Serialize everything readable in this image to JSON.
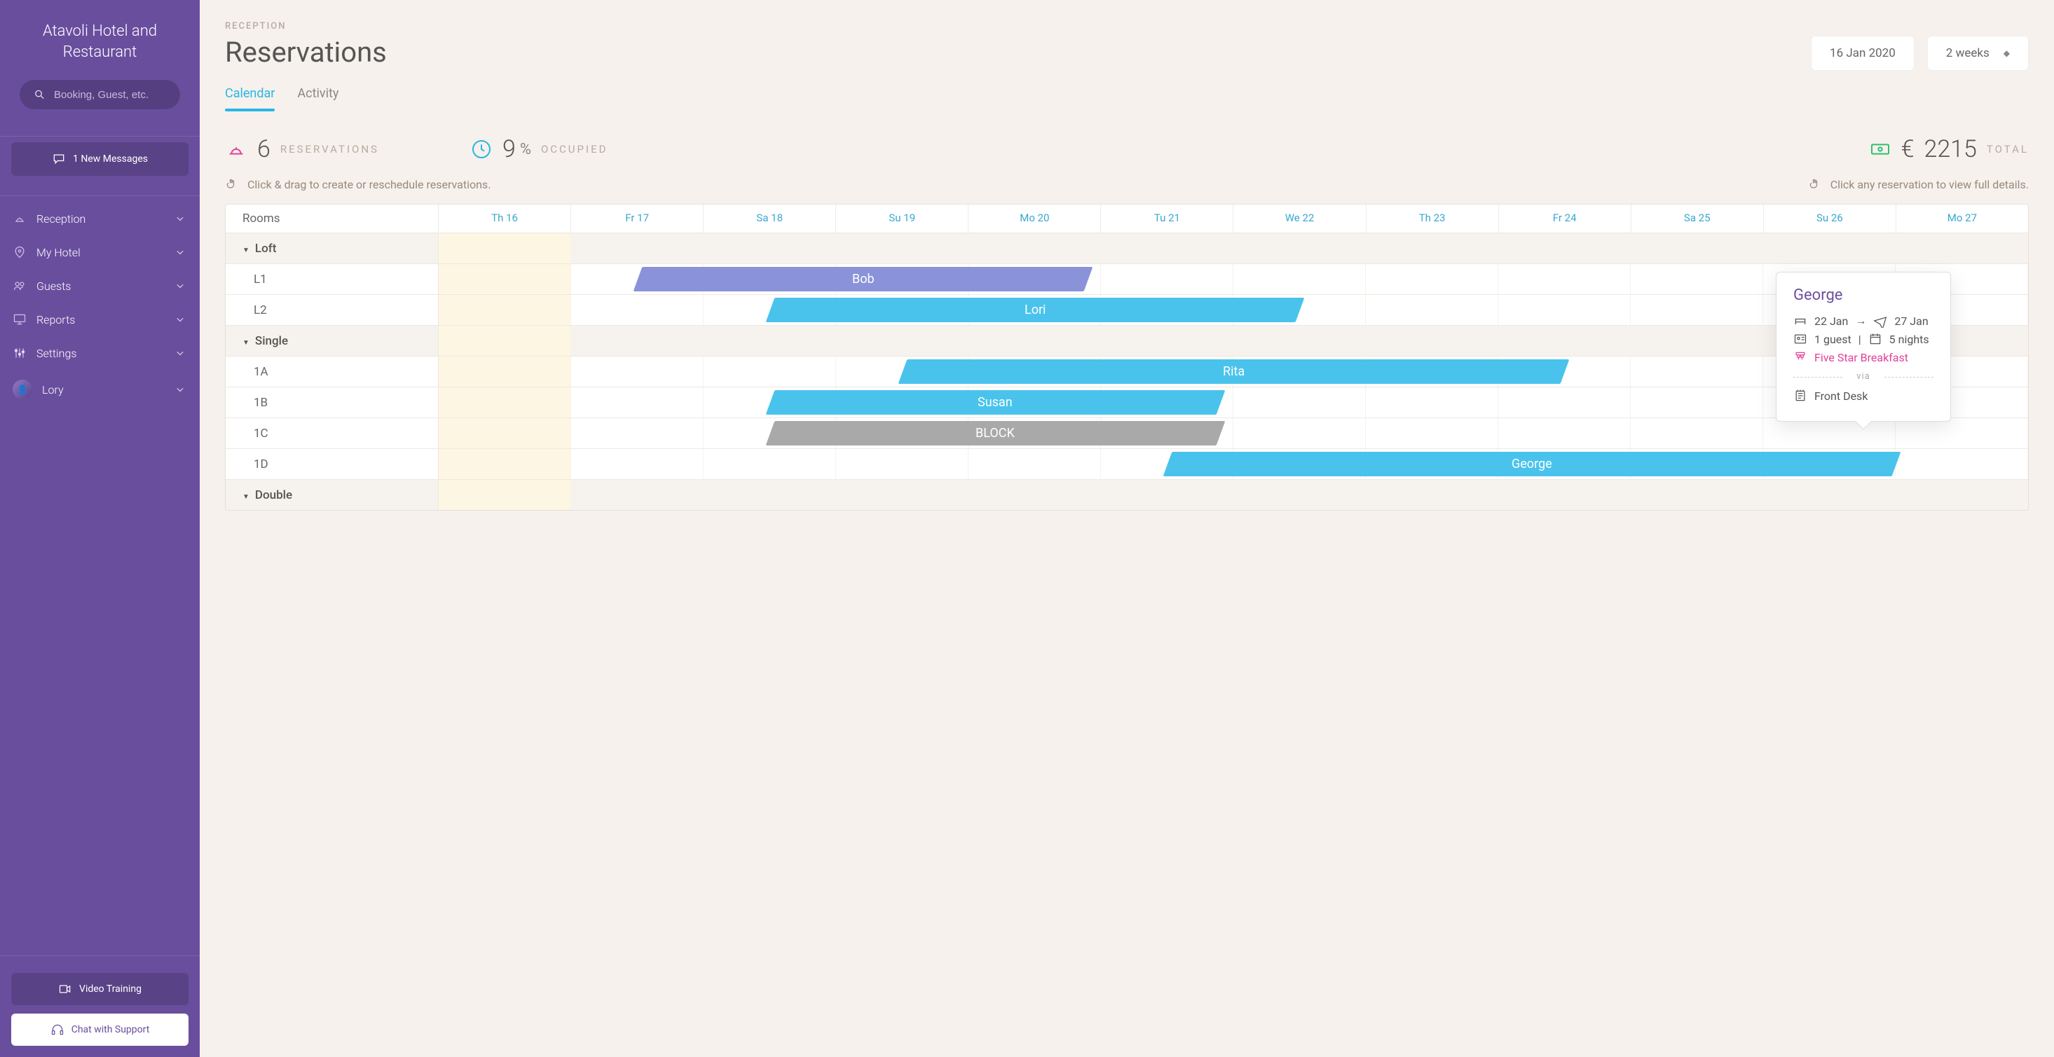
{
  "brand": "Atavoli Hotel and Restaurant",
  "search": {
    "placeholder": "Booking, Guest, etc."
  },
  "messages": "1 New Messages",
  "nav": [
    {
      "label": "Reception",
      "icon": "bell"
    },
    {
      "label": "My Hotel",
      "icon": "pin"
    },
    {
      "label": "Guests",
      "icon": "group"
    },
    {
      "label": "Reports",
      "icon": "monitor"
    },
    {
      "label": "Settings",
      "icon": "sliders"
    }
  ],
  "user": {
    "name": "Lory"
  },
  "bottom": {
    "video": "Video Training",
    "chat": "Chat with Support"
  },
  "crumb": "RECEPTION",
  "title": "Reservations",
  "date_control": "16 Jan 2020",
  "range_control": "2 weeks",
  "tabs": {
    "calendar": "Calendar",
    "activity": "Activity"
  },
  "stats": {
    "reservations": {
      "value": "6",
      "label": "RESERVATIONS"
    },
    "occupied": {
      "value": "9",
      "pct": "%",
      "label": "OCCUPIED"
    },
    "total": {
      "currency": "€",
      "value": "2215",
      "label": "TOTAL"
    }
  },
  "hints": {
    "drag": "Click & drag to create or reschedule reservations.",
    "view": "Click any reservation to view full details."
  },
  "calendar": {
    "rooms_header": "Rooms",
    "days": [
      "Th 16",
      "Fr 17",
      "Sa 18",
      "Su 19",
      "Mo 20",
      "Tu 21",
      "We 22",
      "Th 23",
      "Fr 24",
      "Sa 25",
      "Su 26",
      "Mo 27"
    ],
    "groups": [
      {
        "name": "Loft",
        "rooms": [
          {
            "name": "L1",
            "bars": [
              {
                "label": "Bob",
                "start": 1.5,
                "len": 3.4,
                "color": "lav"
              }
            ]
          },
          {
            "name": "L2",
            "bars": [
              {
                "label": "Lori",
                "start": 2.5,
                "len": 4.0,
                "color": "blue"
              }
            ]
          }
        ]
      },
      {
        "name": "Single",
        "rooms": [
          {
            "name": "1A",
            "bars": [
              {
                "label": "Rita",
                "start": 3.5,
                "len": 5.0,
                "color": "blue"
              }
            ]
          },
          {
            "name": "1B",
            "bars": [
              {
                "label": "Susan",
                "start": 2.5,
                "len": 3.4,
                "color": "blue"
              }
            ]
          },
          {
            "name": "1C",
            "bars": [
              {
                "label": "BLOCK",
                "start": 2.5,
                "len": 3.4,
                "color": "grey"
              }
            ]
          },
          {
            "name": "1D",
            "bars": [
              {
                "label": "George",
                "start": 5.5,
                "len": 5.5,
                "color": "blue"
              }
            ]
          }
        ]
      },
      {
        "name": "Double",
        "rooms": []
      }
    ]
  },
  "tooltip": {
    "name": "George",
    "checkin": "22 Jan",
    "checkout": "27 Jan",
    "guests": "1 guest",
    "nights": "5 nights",
    "plan": "Five Star Breakfast",
    "via_label": "via",
    "source": "Front Desk"
  }
}
